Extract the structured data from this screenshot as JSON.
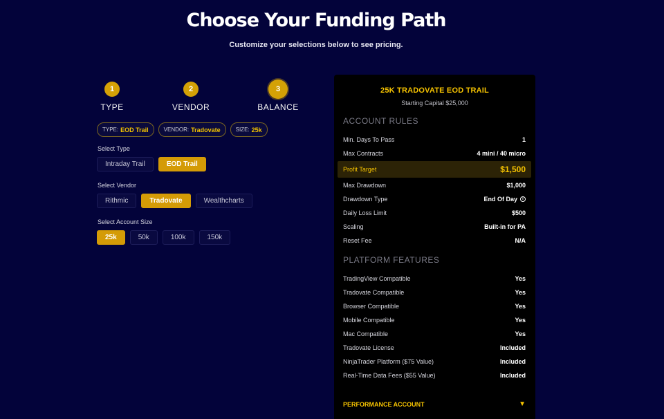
{
  "header": {
    "title": "Choose Your Funding Path",
    "subtitle": "Customize your selections below to see pricing."
  },
  "steps": [
    {
      "num": "1",
      "label": "TYPE"
    },
    {
      "num": "2",
      "label": "VENDOR"
    },
    {
      "num": "3",
      "label": "BALANCE"
    }
  ],
  "tags": {
    "type_key": "TYPE:",
    "type_val": "EOD Trail",
    "vendor_key": "VENDOR:",
    "vendor_val": "Tradovate",
    "size_key": "SIZE:",
    "size_val": "25k"
  },
  "select_type": {
    "label": "Select Type",
    "options": [
      "Intraday Trail",
      "EOD Trail"
    ],
    "selected": "EOD Trail"
  },
  "select_vendor": {
    "label": "Select Vendor",
    "options": [
      "Rithmic",
      "Tradovate",
      "Wealthcharts"
    ],
    "selected": "Tradovate"
  },
  "select_size": {
    "label": "Select Account Size",
    "options": [
      "25k",
      "50k",
      "100k",
      "150k"
    ],
    "selected": "25k"
  },
  "panel": {
    "title": "25K TRADOVATE EOD TRAIL",
    "subtitle": "Starting Capital $25,000",
    "rules_heading": "ACCOUNT RULES",
    "rules": [
      {
        "k": "Min. Days To Pass",
        "v": "1"
      },
      {
        "k": "Max Contracts",
        "v": "4 mini / 40 micro"
      },
      {
        "k": "Profit Target",
        "v": "$1,500"
      },
      {
        "k": "Max Drawdown",
        "v": "$1,000"
      },
      {
        "k": "Drawdown Type",
        "v": "End Of Day"
      },
      {
        "k": "Daily Loss Limit",
        "v": "$500"
      },
      {
        "k": "Scaling",
        "v": "Built-in for PA"
      },
      {
        "k": "Reset Fee",
        "v": "N/A"
      }
    ],
    "features_heading": "PLATFORM FEATURES",
    "features": [
      {
        "k": "TradingView Compatible",
        "v": "Yes"
      },
      {
        "k": "Tradovate Compatible",
        "v": "Yes"
      },
      {
        "k": "Browser Compatible",
        "v": "Yes"
      },
      {
        "k": "Mobile Compatible",
        "v": "Yes"
      },
      {
        "k": "Mac Compatible",
        "v": "Yes"
      },
      {
        "k": "Tradovate License",
        "v": "Included"
      },
      {
        "k": "NinjaTrader Platform ($75 Value)",
        "v": "Included"
      },
      {
        "k": "Real-Time Data Fees ($55 Value)",
        "v": "Included"
      }
    ],
    "perf_label": "PERFORMANCE ACCOUNT",
    "perf_arrow": "▼"
  },
  "colors": {
    "background": "#03033a",
    "accent": "#d49b06",
    "highlight_text": "#f6c300"
  }
}
